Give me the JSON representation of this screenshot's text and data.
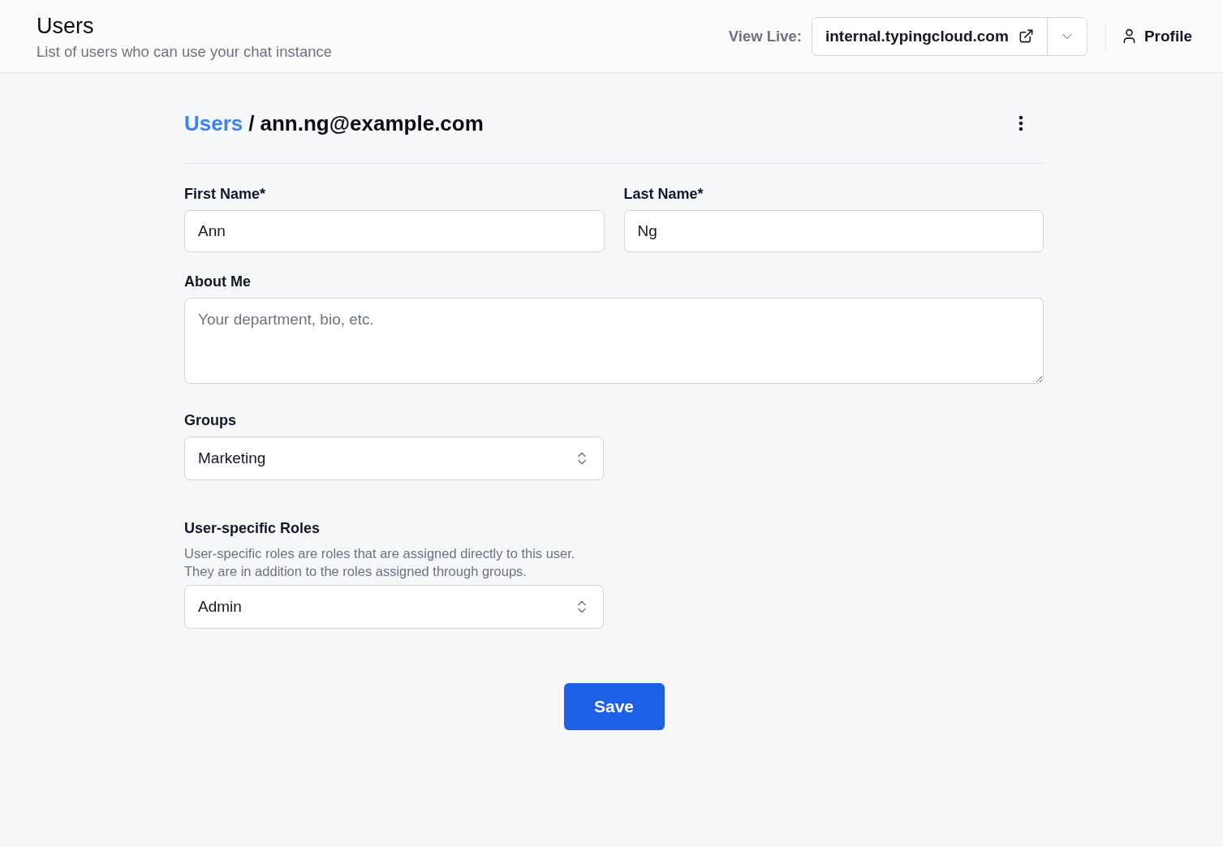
{
  "header": {
    "title": "Users",
    "subtitle": "List of users who can use your chat instance",
    "view_live_label": "View Live:",
    "live_site": "internal.typingcloud.com",
    "profile": "Profile"
  },
  "breadcrumb": [
    {
      "label": "Users",
      "kind": "link"
    },
    {
      "label": "/",
      "kind": "separator"
    },
    {
      "label": "ann.ng@example.com",
      "kind": "current"
    }
  ],
  "form": {
    "name_fields": [
      {
        "label": "First Name*",
        "value": "Ann"
      },
      {
        "label": "Last Name*",
        "value": "Ng"
      }
    ],
    "about": {
      "label": "About Me",
      "placeholder": "Your department, bio, etc."
    },
    "groups": {
      "label": "Groups",
      "value": "Marketing"
    },
    "roles": {
      "label": "User-specific Roles",
      "help_lines": [
        "User-specific roles are roles that are assigned directly to this user.",
        "They are in addition to the roles assigned through groups."
      ],
      "value": "Admin"
    }
  },
  "save_button": "Save"
}
